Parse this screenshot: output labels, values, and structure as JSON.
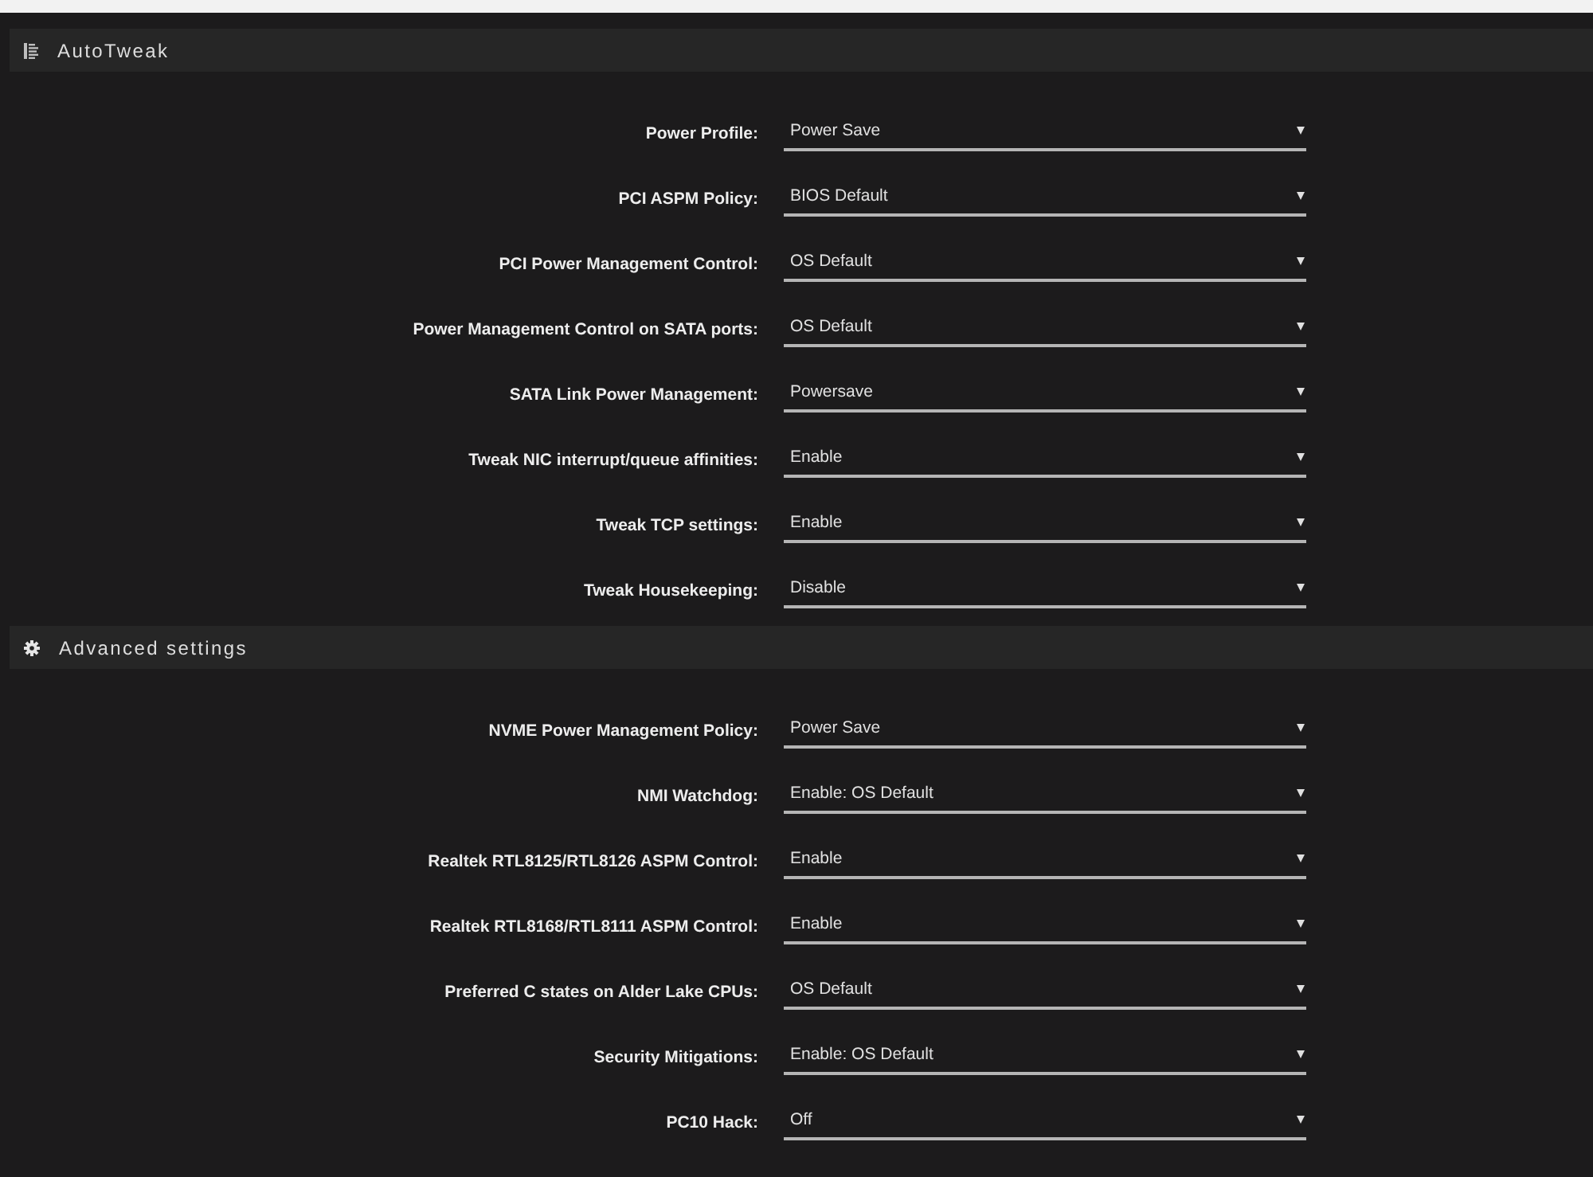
{
  "sections": [
    {
      "title": "AutoTweak",
      "settings": [
        {
          "label": "Power Profile:",
          "value": "Power Save"
        },
        {
          "label": "PCI ASPM Policy:",
          "value": "BIOS Default"
        },
        {
          "label": "PCI Power Management Control:",
          "value": "OS Default"
        },
        {
          "label": "Power Management Control on SATA ports:",
          "value": "OS Default"
        },
        {
          "label": "SATA Link Power Management:",
          "value": "Powersave"
        },
        {
          "label": "Tweak NIC interrupt/queue affinities:",
          "value": "Enable"
        },
        {
          "label": "Tweak TCP settings:",
          "value": "Enable"
        },
        {
          "label": "Tweak Housekeeping:",
          "value": "Disable"
        }
      ]
    },
    {
      "title": "Advanced settings",
      "settings": [
        {
          "label": "NVME Power Management Policy:",
          "value": "Power Save"
        },
        {
          "label": "NMI Watchdog:",
          "value": "Enable: OS Default"
        },
        {
          "label": "Realtek RTL8125/RTL8126 ASPM Control:",
          "value": "Enable"
        },
        {
          "label": "Realtek RTL8168/RTL8111 ASPM Control:",
          "value": "Enable"
        },
        {
          "label": "Preferred C states on Alder Lake CPUs:",
          "value": "OS Default"
        },
        {
          "label": "Security Mitigations:",
          "value": "Enable: OS Default"
        },
        {
          "label": "PC10 Hack:",
          "value": "Off"
        }
      ]
    }
  ]
}
